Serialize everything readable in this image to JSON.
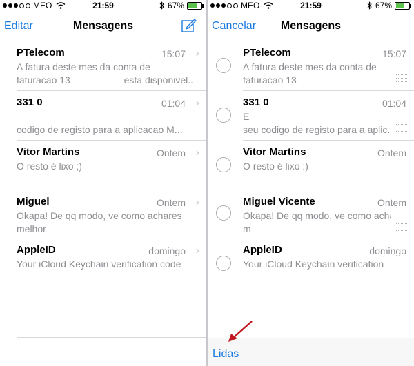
{
  "status_bar": {
    "carrier": "MEO",
    "time": "21:59",
    "battery": "67%",
    "battery_level": 0.67
  },
  "left": {
    "nav": {
      "left_button": "Editar",
      "title": "Mensagens"
    },
    "rows": [
      {
        "name": "PTelecom",
        "time": "15:07",
        "preview": "A fatura deste mes da conta de\nfaturacao 13                    esta disponivel..."
      },
      {
        "name": "331 0",
        "time": "01:04",
        "preview": "\ncodigo de registo para a aplicacao M..."
      },
      {
        "name": "Vitor Martins",
        "time": "Ontem",
        "preview": "O resto é lixo ;)"
      },
      {
        "name": "Miguel",
        "time": "Ontem",
        "preview": "Okapa! De qq modo, ve como achares\nmelhor"
      },
      {
        "name": "AppleID",
        "time": "domingo",
        "preview": "Your iCloud Keychain verification code"
      }
    ]
  },
  "right": {
    "nav": {
      "left_button": "Cancelar",
      "title": "Mensagens"
    },
    "rows": [
      {
        "name": "PTelecom",
        "time": "15:07",
        "preview": "A fatura deste mes da conta de\nfaturacao 13"
      },
      {
        "name": "331 0",
        "time": "01:04",
        "preview": "E\nseu codigo de registo para a aplic..."
      },
      {
        "name": "Vitor Martins",
        "time": "Ontem",
        "preview": "O resto é lixo ;)"
      },
      {
        "name": "Miguel Vicente",
        "time": "Ontem",
        "preview": "Okapa! De qq modo, ve como achares\nm"
      },
      {
        "name": "AppleID",
        "time": "domingo",
        "preview": "Your iCloud Keychain verification"
      }
    ],
    "toolbar": {
      "button": "Lidas"
    }
  }
}
